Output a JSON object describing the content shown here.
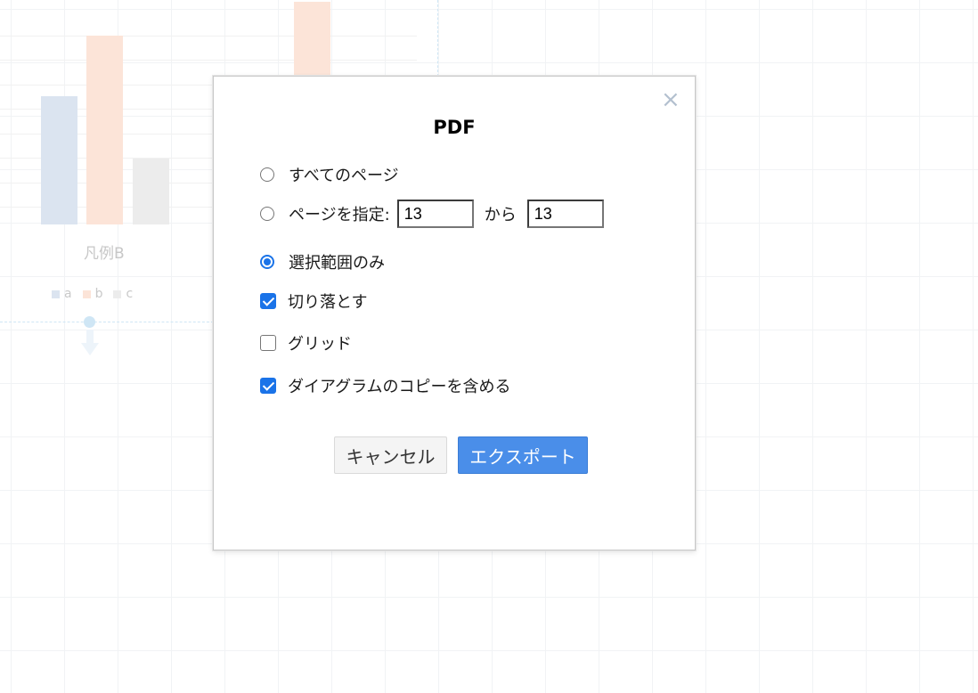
{
  "background": {
    "chart": {
      "label": "凡例B",
      "legend": [
        "a",
        "b",
        "c"
      ],
      "colors": {
        "a": "#dbe4f0",
        "b": "#fce4d8",
        "c": "#ececec"
      }
    }
  },
  "dialog": {
    "title": "PDF",
    "close_icon": "close-icon",
    "options": {
      "all_pages": {
        "label": "すべてのページ",
        "selected": false
      },
      "page_range": {
        "label": "ページを指定:",
        "from": "13",
        "separator": "から",
        "to": "13",
        "selected": false
      },
      "selection_only": {
        "label": "選択範囲のみ",
        "selected": true
      }
    },
    "checkboxes": {
      "crop": {
        "label": "切り落とす",
        "checked": true
      },
      "grid": {
        "label": "グリッド",
        "checked": false
      },
      "include_copy": {
        "label": "ダイアグラムのコピーを含める",
        "checked": true
      }
    },
    "buttons": {
      "cancel": "キャンセル",
      "export": "エクスポート"
    },
    "accent_color": "#1a73e8",
    "export_button_color": "#4a8ee9"
  }
}
